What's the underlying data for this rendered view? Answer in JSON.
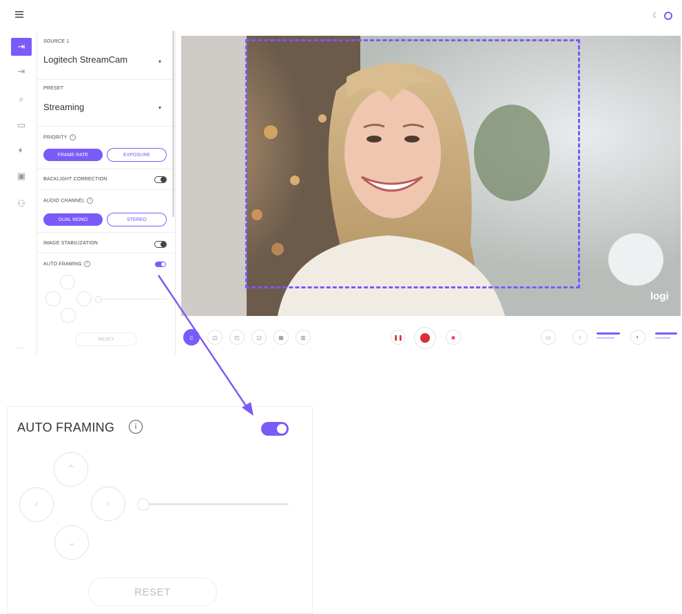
{
  "source": {
    "label": "SOURCE 1",
    "value": "Logitech StreamCam"
  },
  "preset": {
    "label": "PRESET",
    "value": "Streaming"
  },
  "priority": {
    "label": "PRIORITY",
    "options": [
      "FRAME RATE",
      "EXPOSURE"
    ],
    "selected": "FRAME RATE"
  },
  "backlight": {
    "label": "BACKLIGHT CORRECTION",
    "enabled": false
  },
  "audio_channel": {
    "label": "AUDIO CHANNEL",
    "options": [
      "DUAL MONO",
      "STEREO"
    ],
    "selected": "DUAL MONO"
  },
  "stabilization": {
    "label": "IMAGE STABILIZATION",
    "enabled": false
  },
  "auto_framing": {
    "label": "AUTO FRAMING",
    "enabled": true,
    "reset_label": "RESET"
  },
  "zoom_panel": {
    "title": "AUTO FRAMING",
    "reset_label": "RESET",
    "toggle_on": true
  },
  "rail": {
    "items": [
      "source-in-icon",
      "source-2-icon",
      "search-icon",
      "camera-icon",
      "speaker-icon",
      "fx-icon",
      "user-icon"
    ],
    "more": "..."
  },
  "video": {
    "watermark": "logi",
    "frame_color": "#7a5af8"
  },
  "colors": {
    "accent": "#7a5af8",
    "record": "#e02d3c"
  }
}
